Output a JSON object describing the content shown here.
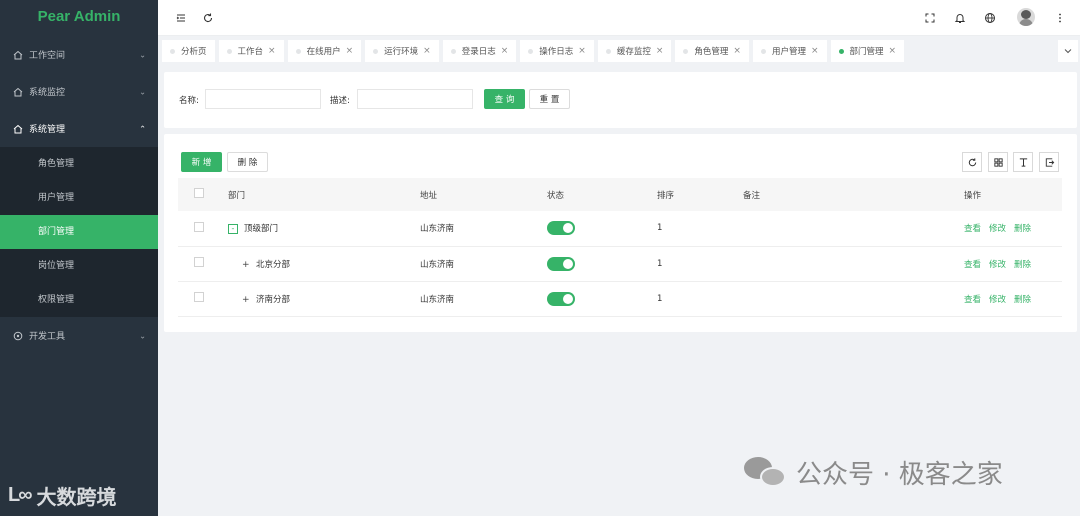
{
  "sidebar": {
    "logo": "Pear Admin",
    "groups": [
      {
        "label": "工作空间",
        "arrow": "⌄"
      },
      {
        "label": "系统监控",
        "arrow": "⌄"
      },
      {
        "label": "系统管理",
        "arrow": "⌃"
      },
      {
        "label": "开发工具",
        "arrow": "⌄"
      }
    ],
    "submenu": [
      "角色管理",
      "用户管理",
      "部门管理",
      "岗位管理",
      "权限管理"
    ],
    "active_submenu": "部门管理",
    "watermark": "大数跨境",
    "watermark_mark": "L∞"
  },
  "header": {
    "icons": [
      "menu-fold-icon",
      "refresh-icon",
      "fullscreen-icon",
      "bell-icon",
      "globe-icon",
      "avatar",
      "more-icon"
    ]
  },
  "tabs": [
    {
      "label": "分析页",
      "closable": false
    },
    {
      "label": "工作台",
      "closable": true
    },
    {
      "label": "在线用户",
      "closable": true
    },
    {
      "label": "运行环境",
      "closable": true
    },
    {
      "label": "登录日志",
      "closable": true
    },
    {
      "label": "操作日志",
      "closable": true
    },
    {
      "label": "缓存监控",
      "closable": true
    },
    {
      "label": "角色管理",
      "closable": true
    },
    {
      "label": "用户管理",
      "closable": true
    },
    {
      "label": "部门管理",
      "closable": true,
      "active": true
    }
  ],
  "search": {
    "name_label": "名称:",
    "name_value": "",
    "desc_label": "描述:",
    "desc_value": "",
    "query_button": "查 询",
    "reset_button": "重 置"
  },
  "table_toolbar": {
    "add_button": "新 增",
    "delete_button": "删 除"
  },
  "table": {
    "columns": [
      "部门",
      "地址",
      "状态",
      "排序",
      "备注",
      "操作"
    ],
    "rows": [
      {
        "name": "顶级部门",
        "address": "山东济南",
        "status": true,
        "sort": "1",
        "remark": "",
        "level": 0,
        "expand": "-"
      },
      {
        "name": "北京分部",
        "address": "山东济南",
        "status": true,
        "sort": "1",
        "remark": "",
        "level": 1,
        "expand": "+"
      },
      {
        "name": "济南分部",
        "address": "山东济南",
        "status": true,
        "sort": "1",
        "remark": "",
        "level": 1,
        "expand": "+"
      }
    ],
    "actions": {
      "view": "查看",
      "edit": "修改",
      "delete": "删除"
    }
  },
  "watermark_right": "公众号 · 极客之家",
  "colors": {
    "accent": "#36b368",
    "sidebar_bg": "#28333e",
    "submenu_bg": "#1e262e"
  }
}
